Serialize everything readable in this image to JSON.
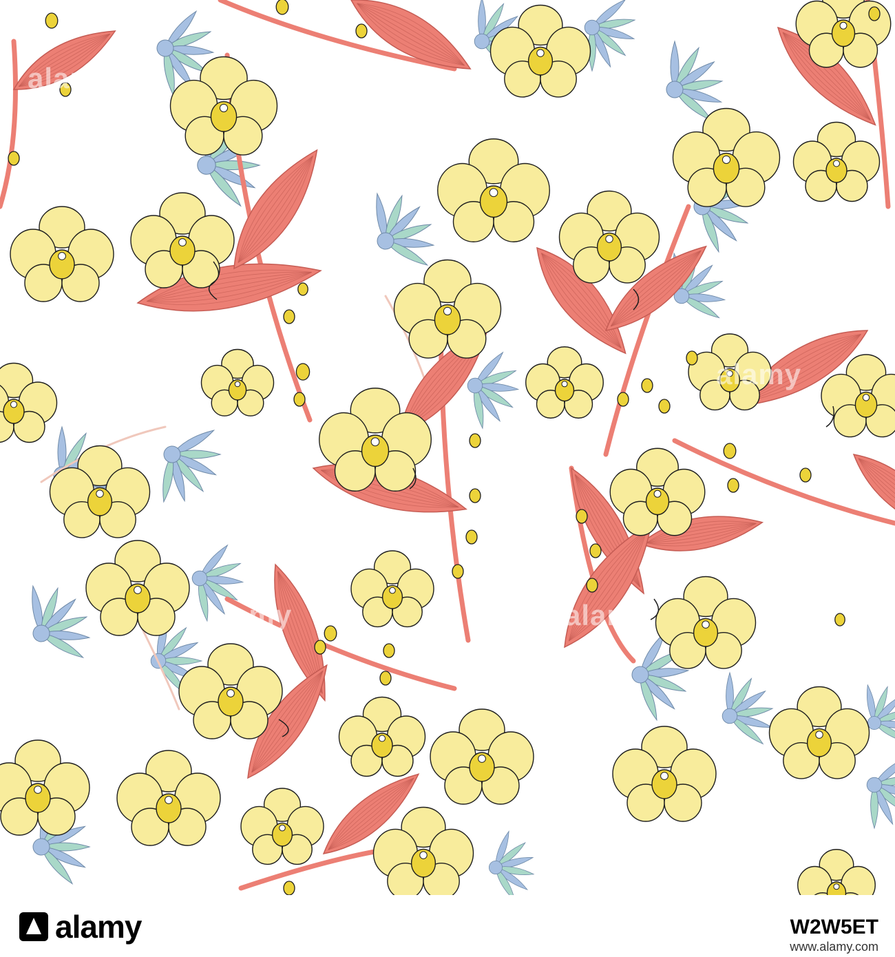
{
  "watermark": {
    "text": "alamy"
  },
  "footer": {
    "logo": "alamy",
    "image_id": "W2W5ET",
    "url": "www.alamy.com"
  },
  "palette": {
    "background": "#ffffff",
    "petal": "#f8ec9c",
    "petal_center": "#ecd33a",
    "leaf": "#ec7f74",
    "leaf_vein": "#c55c54",
    "foliage_blue": "#a7c0e2",
    "foliage_green": "#a9d8c8",
    "stem": "#f0c8bc",
    "outline": "#1f1f1f"
  }
}
